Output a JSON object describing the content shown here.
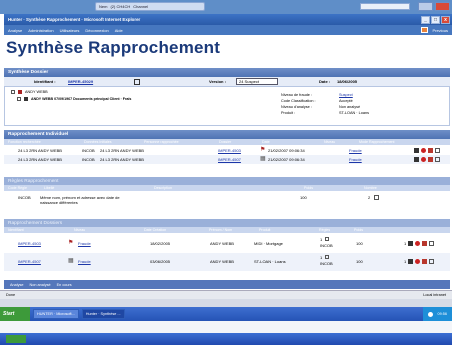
{
  "top_bar": {
    "tabs": [
      "Nem",
      "(2) CH4CH",
      "Channel"
    ]
  },
  "window": {
    "title": "Hunter · Synthèse Rapprochement · Microsoft Internet Explorer",
    "menu_items": [
      "Analyse",
      "Administration",
      "Utilisateurs",
      "Déconnexion",
      "Aide"
    ],
    "menu_right_label": "Previous"
  },
  "page": {
    "title": "Synthèse Rapprochement"
  },
  "dossier": {
    "section_title": "Synthèse Dossier",
    "identifiant_label": "Identifiant :",
    "identifiant_value": "IMPER-45029",
    "version_label": "Version :",
    "version_value": "24 Suspect",
    "date_label": "Date :",
    "date_value": "18/06/2005",
    "tree_root": "ANDY WEBB",
    "tree_child": "ANDY WEBB 07/09/1967 Documents principal Client · Fraîs",
    "fields": [
      {
        "label": "Niveau de fraude :",
        "value": "Suspect",
        "link": true
      },
      {
        "label": "Code Classification :",
        "value": "Accepté",
        "link": false
      },
      {
        "label": "Niveau d'analyse :",
        "value": "Non analysé",
        "link": false
      },
      {
        "label": "Produit :",
        "value": "ST-LOAN · Loans",
        "link": false
      }
    ]
  },
  "rapprochement": {
    "section_title": "Rapprochement Individuel",
    "columns": [
      "Fonction recherchée",
      "Données Initiales",
      "Personne rapprochée",
      "Dossier",
      "Date",
      "Niveau",
      "Mode Rapprochement"
    ],
    "rows": [
      {
        "code": "24 L3 2RN ANDY WEBB",
        "type": "INCOB",
        "match": "24 L3 2RN ANDY WEBB",
        "dossier": "IMPER-4503",
        "date": "21/02/2007 09:06:34",
        "niveau": "Fraude"
      },
      {
        "code": "24 L3 2RN ANDY WEBB",
        "type": "INCOB",
        "match": "24 L3 2RN ANDY WEBB",
        "dossier": "IMPER-4507",
        "date": "21/02/2007 09:06:34",
        "niveau": "Fraude"
      }
    ]
  },
  "regles": {
    "section_title": "Règles Rapprochement",
    "columns": [
      "Code Règle",
      "Libellé",
      "Description",
      "Poids",
      "Nombre"
    ],
    "rows": [
      {
        "code": "INCOB",
        "libelle": "Même nom, prénom et adresse avec date de",
        "libelle2": "naissance différentes",
        "poids": "100",
        "nombre": "2"
      }
    ]
  },
  "dossiers": {
    "section_title": "Rapprochement Dossiers",
    "columns": [
      "Identifiant",
      "Niveau",
      "Date Création",
      "Prénom / Nom",
      "Produit",
      "Règles",
      "Poids"
    ],
    "rows": [
      {
        "id": "IMPER-4503",
        "niveau": "Fraude",
        "date": "18/02/2005",
        "nom": "ANDY WEBB",
        "produit": "MIDI · Mortgage",
        "regle_count": "1",
        "regle": "INCOB",
        "poids": "100"
      },
      {
        "id": "IMPER-4507",
        "niveau": "Fraude",
        "date": "03/06/2005",
        "nom": "ANDY WEBB",
        "produit": "ST-LOAN · Loans",
        "regle_count": "1",
        "regle": "INCOB",
        "poids": "100"
      }
    ]
  },
  "footer_links": [
    "Analyse",
    "Non analysé",
    "En cours"
  ],
  "status": {
    "left": "Done",
    "right": "Local intranet"
  },
  "taskbar": {
    "start": "Start",
    "buttons": [
      "HUNTER · Microsoft...",
      "Hunter · Synthèse ..."
    ],
    "tray_time": "09:56"
  },
  "colors": {
    "section_header": "#4f73b4",
    "title_text": "#1b3a7a",
    "link": "#1c36a8",
    "taskbar": "#2553b5"
  }
}
